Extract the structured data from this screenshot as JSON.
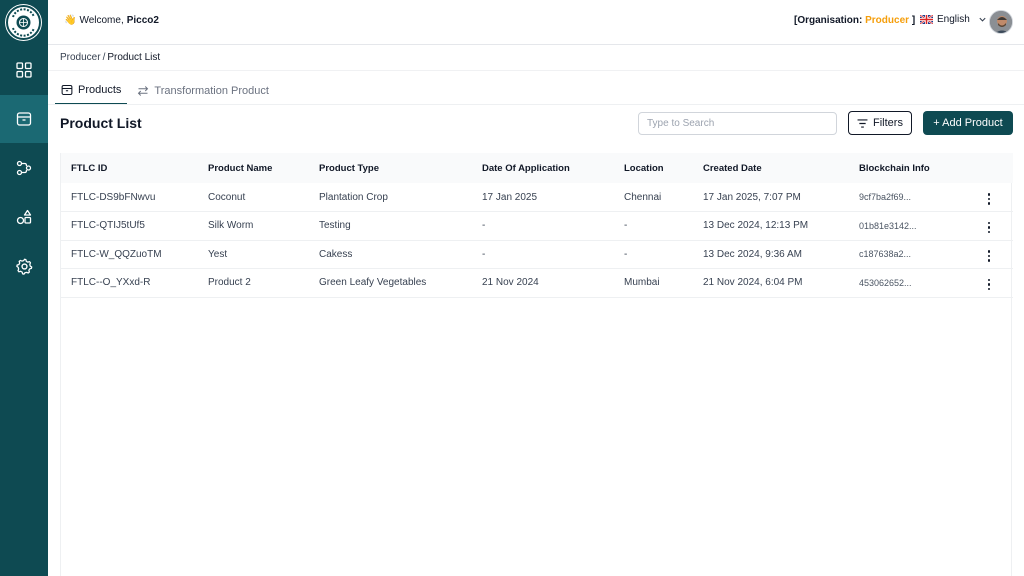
{
  "brand": {
    "logo_text": "FOOD TRAZER"
  },
  "sidebar": {
    "items": [
      {
        "name": "dashboard",
        "icon": "dashboard-grid-icon",
        "active": false
      },
      {
        "name": "products",
        "icon": "box-icon",
        "active": true
      },
      {
        "name": "supply-chain",
        "icon": "flow-icon",
        "active": false
      },
      {
        "name": "shapes",
        "icon": "shapes-icon",
        "active": false
      },
      {
        "name": "settings",
        "icon": "gear-icon",
        "active": false
      }
    ]
  },
  "header": {
    "wave": "👋",
    "welcome_prefix": "Welcome,",
    "username": "Picco2",
    "org_open": "[Organisation:",
    "org_value": "Producer",
    "org_close": "]",
    "language": "English"
  },
  "breadcrumb": {
    "parent": "Producer",
    "separator": "/",
    "current": "Product List"
  },
  "tabs": [
    {
      "label": "Products",
      "icon": "box-icon",
      "active": true
    },
    {
      "label": "Transformation Product",
      "icon": "transform-arrows-icon",
      "active": false
    }
  ],
  "page": {
    "title": "Product List",
    "search_placeholder": "Type to Search",
    "filter_label": "Filters",
    "add_label": "+ Add Product"
  },
  "table": {
    "columns": [
      "FTLC ID",
      "Product Name",
      "Product Type",
      "Date Of Application",
      "Location",
      "Created Date",
      "Blockchain Info"
    ],
    "rows": [
      [
        "FTLC-DS9bFNwvu",
        "Coconut",
        "Plantation Crop",
        "17 Jan 2025",
        "Chennai",
        "17 Jan 2025, 7:07 PM",
        "9cf7ba2f69..."
      ],
      [
        "FTLC-QTIJ5tUf5",
        "Silk Worm",
        "Testing",
        "-",
        "-",
        "13 Dec 2024, 12:13 PM",
        "01b81e3142..."
      ],
      [
        "FTLC-W_QQZuoTM",
        "Yest",
        "Cakess",
        "-",
        "-",
        "13 Dec 2024, 9:36 AM",
        "c187638a2..."
      ],
      [
        "FTLC--O_YXxd-R",
        "Product 2",
        "Green Leafy Vegetables",
        "21 Nov 2024",
        "Mumbai",
        "21 Nov 2024, 6:04 PM",
        "453062652..."
      ]
    ]
  },
  "colors": {
    "sidebar": "#0e4a52",
    "sidebar_active": "#1b6973",
    "accent_org": "#f59e0b",
    "primary_button": "#0e4a52"
  }
}
